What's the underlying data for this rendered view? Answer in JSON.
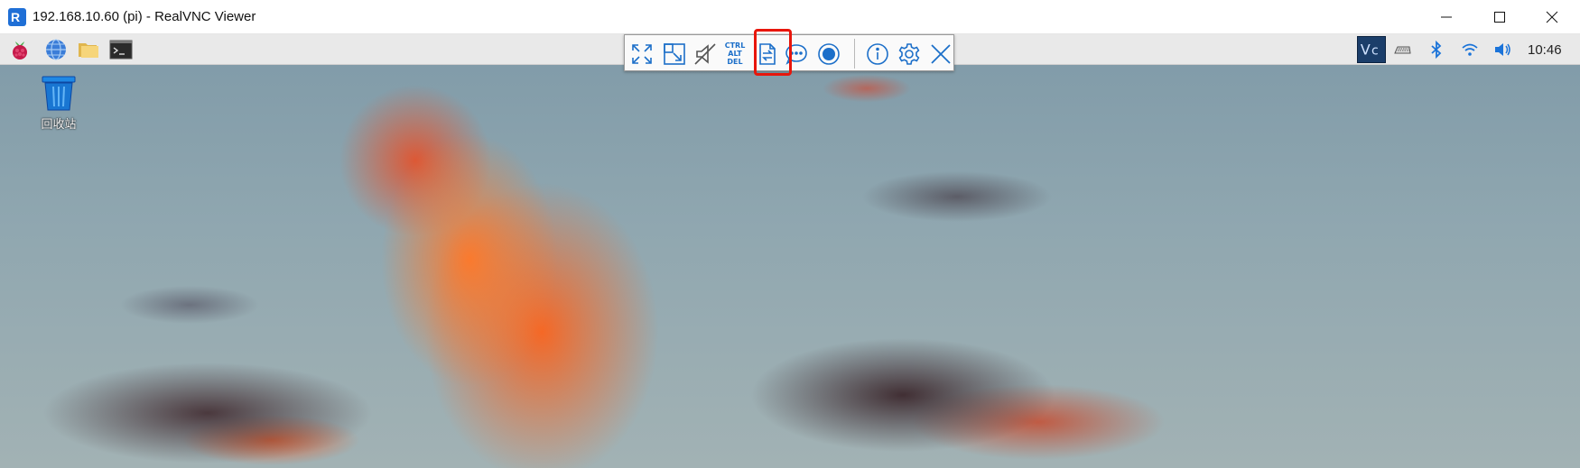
{
  "window": {
    "title": "192.168.10.60 (pi) - RealVNC Viewer",
    "icon": "realvnc-app-icon",
    "controls": [
      "minimize-icon",
      "maximize-icon",
      "close-icon"
    ]
  },
  "taskbar": {
    "launchers": [
      "raspberry-menu-icon",
      "browser-globe-icon",
      "file-manager-icon",
      "terminal-icon"
    ],
    "tray": [
      "vnc-server-icon",
      "keyboard-icon",
      "bluetooth-icon",
      "wifi-icon",
      "volume-icon"
    ],
    "clock": "10:46"
  },
  "vnc_toolbar": {
    "buttons": [
      "fullscreen-icon",
      "scale-icon",
      "mute-icon",
      "ctrl-alt-del-icon",
      "file-transfer-icon",
      "chat-icon",
      "record-icon",
      "info-icon",
      "settings-icon",
      "close-icon"
    ],
    "ctrl_alt_del": {
      "line1": "CTRL",
      "line2": "ALT",
      "line3": "DEL"
    },
    "highlighted": "file-transfer-icon",
    "highlight_color": "#e8160c",
    "accent_color": "#1c6fc9"
  },
  "desktop": {
    "icons": [
      {
        "name": "recycle-bin-icon",
        "label": "回收站"
      }
    ]
  }
}
